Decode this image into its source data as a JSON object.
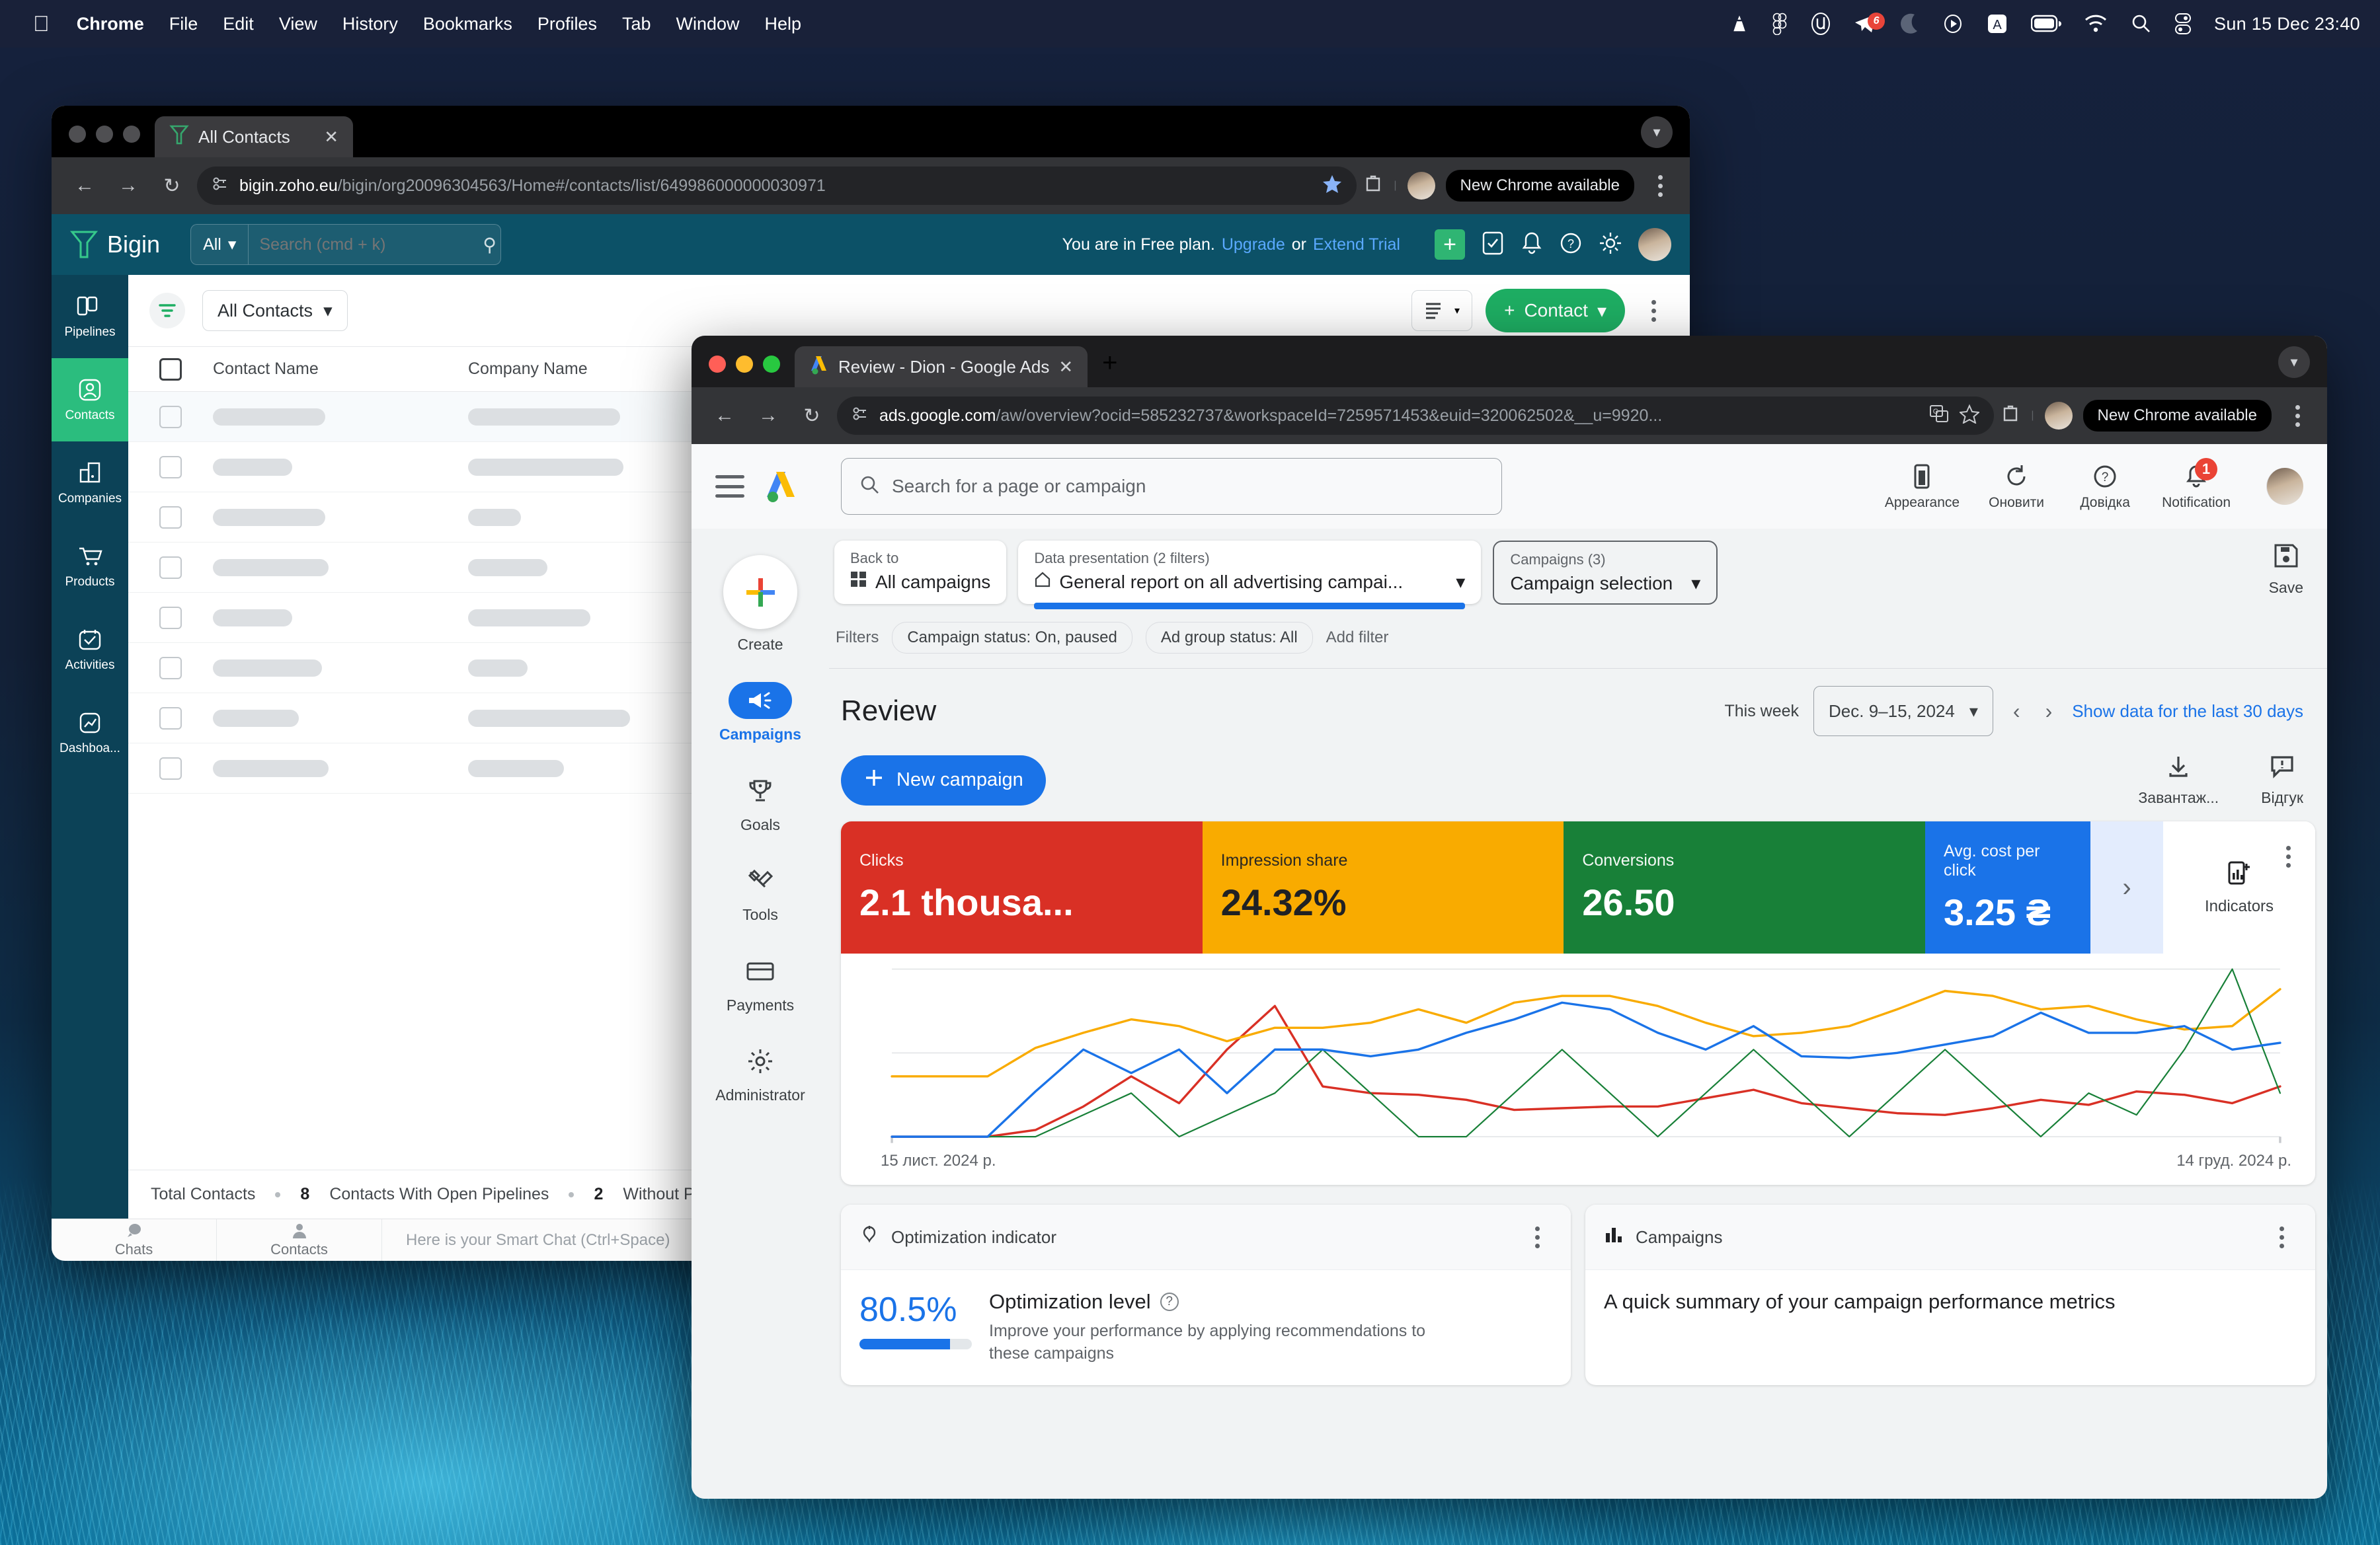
{
  "menubar": {
    "apple": "",
    "items": [
      "Chrome",
      "File",
      "Edit",
      "View",
      "History",
      "Bookmarks",
      "Profiles",
      "Tab",
      "Window",
      "Help"
    ],
    "clock": "Sun 15 Dec  23:40",
    "tray_badge": "6"
  },
  "bigin_window": {
    "tab_title": "All Contacts",
    "url_host": "bigin.zoho.eu",
    "url_rest": "/bigin/org20096304563/Home#/contacts/list/649986000000030971",
    "update_chip": "New Chrome available",
    "header": {
      "brand": "Bigin",
      "search_scope": "All",
      "search_placeholder": "Search (cmd + k)",
      "plan_text": "You are in Free plan.",
      "upgrade": "Upgrade",
      "or": "or",
      "extend_trial": "Extend Trial"
    },
    "sidebar": [
      {
        "label": "Pipelines",
        "icon": "pipelines-icon",
        "active": false
      },
      {
        "label": "Contacts",
        "icon": "contacts-icon",
        "active": true
      },
      {
        "label": "Companies",
        "icon": "companies-icon",
        "active": false
      },
      {
        "label": "Products",
        "icon": "products-icon",
        "active": false
      },
      {
        "label": "Activities",
        "icon": "activities-icon",
        "active": false
      },
      {
        "label": "Dashboa...",
        "icon": "dashboard-icon",
        "active": false
      }
    ],
    "toolbar": {
      "view_name": "All Contacts",
      "contact_button": "Contact"
    },
    "table": {
      "columns": [
        "Contact Name",
        "Company Name"
      ],
      "row_count": 8
    },
    "footer": {
      "total_label": "Total Contacts",
      "total_value": "8",
      "open_label": "Contacts With Open Pipelines",
      "open_value": "2",
      "without_label": "Without Pipelin"
    },
    "smartchat": {
      "chats": "Chats",
      "contacts": "Contacts",
      "placeholder": "Here is your Smart Chat (Ctrl+Space)"
    }
  },
  "ads_window": {
    "tab_title": "Review - Dion - Google Ads",
    "url_host": "ads.google.com",
    "url_rest": "/aw/overview?ocid=585232737&workspaceId=7259571453&euid=320062502&__u=9920...",
    "update_chip": "New Chrome available",
    "topbar": {
      "search_placeholder": "Search for a page or campaign",
      "icons": [
        {
          "label": "Appearance",
          "name": "appearance-icon"
        },
        {
          "label": "Оновити",
          "name": "refresh-icon"
        },
        {
          "label": "Довідка",
          "name": "help-icon"
        },
        {
          "label": "Notification",
          "name": "notification-icon",
          "badge": "1"
        }
      ]
    },
    "sidebar": [
      {
        "label": "Create",
        "icon": "plus-icon",
        "active": false
      },
      {
        "label": "Campaigns",
        "icon": "megaphone-icon",
        "active": true
      },
      {
        "label": "Goals",
        "icon": "trophy-icon",
        "active": false
      },
      {
        "label": "Tools",
        "icon": "tools-icon",
        "active": false
      },
      {
        "label": "Payments",
        "icon": "credit-card-icon",
        "active": false
      },
      {
        "label": "Administrator",
        "icon": "gear-icon",
        "active": false
      }
    ],
    "filterbar": {
      "back_label": "Back to",
      "back_value": "All campaigns",
      "data_label": "Data presentation (2 filters)",
      "data_value": "General report on all advertising campai...",
      "campaigns_label": "Campaigns (3)",
      "campaigns_value": "Campaign selection",
      "filters_label": "Filters",
      "chips": [
        "Campaign status: On, paused",
        "Ad group status: All"
      ],
      "add_filter": "Add filter",
      "save_label": "Save"
    },
    "review": {
      "title": "Review",
      "this_week": "This week",
      "date_range": "Dec. 9–15, 2024",
      "show_last_30": "Show data for the last 30 days",
      "new_campaign": "New campaign",
      "download_label": "Завантаж...",
      "feedback_label": "Відгук",
      "indicators_label": "Indicators"
    },
    "optimization_card": {
      "header": "Optimization indicator",
      "percent": "80.5%",
      "title": "Optimization level",
      "description": "Improve your performance by applying recommendations to these campaigns"
    },
    "campaigns_card": {
      "header": "Campaigns",
      "summary": "A quick summary of your campaign performance metrics"
    }
  },
  "chart_data": {
    "type": "line",
    "title": "",
    "xlabel": "",
    "ylabel": "",
    "x_start_label": "15 лист. 2024 р.",
    "x_end_label": "14 груд. 2024 р.",
    "grid": true,
    "legend_position": "top-kpi-cards",
    "ylim": [
      0,
      100
    ],
    "kpis": [
      {
        "label": "Clicks",
        "value": "2.1 thousa...",
        "color": "#d93025",
        "text_color": "#ffffff"
      },
      {
        "label": "Impression share",
        "value": "24.32%",
        "color": "#f9ab00",
        "text_color": "#202124"
      },
      {
        "label": "Conversions",
        "value": "26.50",
        "color": "#188038",
        "text_color": "#ffffff"
      },
      {
        "label": "Avg. cost per click",
        "value": "3.25 ₴",
        "color": "#1a73e8",
        "text_color": "#ffffff"
      }
    ],
    "x": [
      1,
      2,
      3,
      4,
      5,
      6,
      7,
      8,
      9,
      10,
      11,
      12,
      13,
      14,
      15,
      16,
      17,
      18,
      19,
      20,
      21,
      22,
      23,
      24,
      25,
      26,
      27,
      28,
      29,
      30
    ],
    "series": [
      {
        "name": "Clicks",
        "color": "#d93025",
        "values": [
          0,
          0,
          0,
          4,
          18,
          36,
          20,
          52,
          78,
          30,
          26,
          25,
          22,
          16,
          17,
          18,
          18,
          23,
          28,
          20,
          17,
          14,
          13,
          17,
          22,
          19,
          27,
          25,
          20,
          30
        ]
      },
      {
        "name": "Impression share",
        "color": "#f9ab00",
        "values": [
          36,
          36,
          36,
          53,
          62,
          70,
          66,
          57,
          65,
          65,
          68,
          76,
          68,
          80,
          84,
          84,
          78,
          68,
          60,
          62,
          66,
          76,
          87,
          84,
          76,
          78,
          70,
          64,
          66,
          88
        ]
      },
      {
        "name": "Conversions",
        "color": "#188038",
        "values": [
          0,
          0,
          0,
          0,
          13,
          26,
          0,
          13,
          26,
          52,
          26,
          0,
          0,
          26,
          52,
          26,
          0,
          26,
          52,
          26,
          0,
          26,
          52,
          26,
          0,
          26,
          13,
          52,
          100,
          26
        ]
      },
      {
        "name": "Avg. cost per click",
        "color": "#1a73e8",
        "values": [
          0,
          0,
          0,
          27,
          52,
          38,
          52,
          26,
          52,
          52,
          48,
          52,
          62,
          70,
          80,
          76,
          62,
          52,
          66,
          48,
          47,
          50,
          55,
          60,
          74,
          62,
          62,
          66,
          52,
          56
        ]
      }
    ]
  }
}
